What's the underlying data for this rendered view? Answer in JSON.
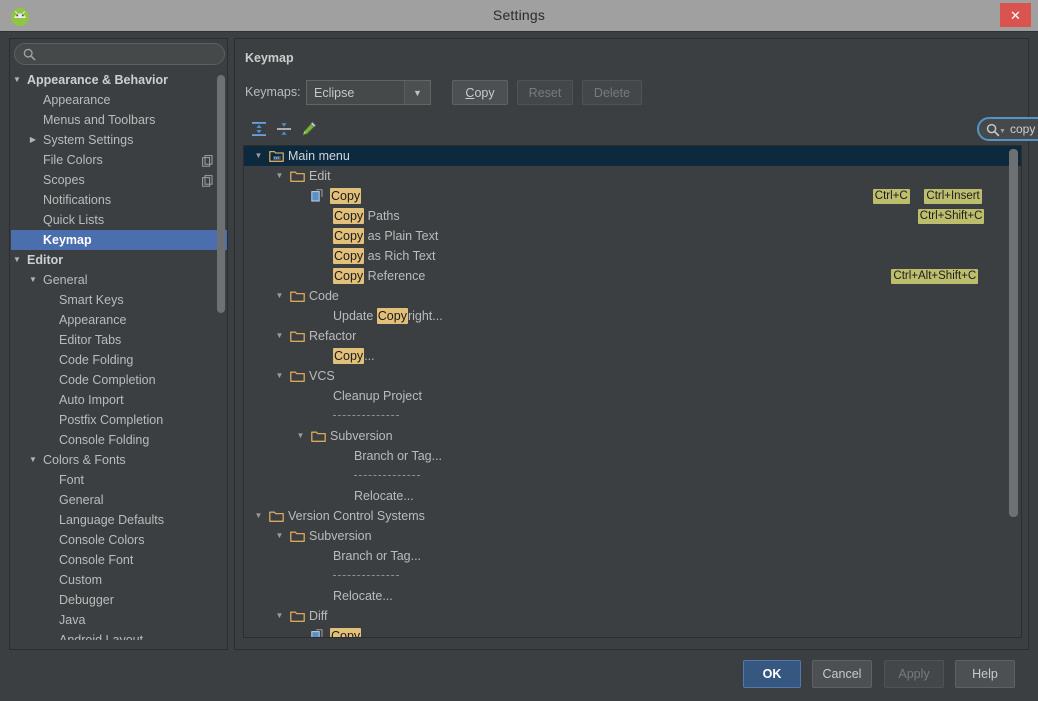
{
  "window": {
    "title": "Settings",
    "app_icon": "android-studio-icon",
    "close_label": "✕"
  },
  "sidebar": {
    "search": {
      "value": "",
      "placeholder": "",
      "icon": "search-icon"
    },
    "items": [
      {
        "label": "Appearance & Behavior",
        "depth": 0,
        "twisty": "▼",
        "bold": true,
        "selected": false,
        "badge": false
      },
      {
        "label": "Appearance",
        "depth": 1,
        "twisty": "",
        "bold": false,
        "selected": false,
        "badge": false
      },
      {
        "label": "Menus and Toolbars",
        "depth": 1,
        "twisty": "",
        "bold": false,
        "selected": false,
        "badge": false
      },
      {
        "label": "System Settings",
        "depth": 1,
        "twisty": "▶",
        "bold": false,
        "selected": false,
        "badge": false
      },
      {
        "label": "File Colors",
        "depth": 1,
        "twisty": "",
        "bold": false,
        "selected": false,
        "badge": true
      },
      {
        "label": "Scopes",
        "depth": 1,
        "twisty": "",
        "bold": false,
        "selected": false,
        "badge": true
      },
      {
        "label": "Notifications",
        "depth": 1,
        "twisty": "",
        "bold": false,
        "selected": false,
        "badge": false
      },
      {
        "label": "Quick Lists",
        "depth": 1,
        "twisty": "",
        "bold": false,
        "selected": false,
        "badge": false
      },
      {
        "label": "Keymap",
        "depth": 1,
        "twisty": "",
        "bold": true,
        "selected": true,
        "badge": false
      },
      {
        "label": "Editor",
        "depth": 0,
        "twisty": "▼",
        "bold": true,
        "selected": false,
        "badge": false
      },
      {
        "label": "General",
        "depth": 1,
        "twisty": "▼",
        "bold": false,
        "selected": false,
        "badge": false
      },
      {
        "label": "Smart Keys",
        "depth": 2,
        "twisty": "",
        "bold": false,
        "selected": false,
        "badge": false
      },
      {
        "label": "Appearance",
        "depth": 2,
        "twisty": "",
        "bold": false,
        "selected": false,
        "badge": false
      },
      {
        "label": "Editor Tabs",
        "depth": 2,
        "twisty": "",
        "bold": false,
        "selected": false,
        "badge": false
      },
      {
        "label": "Code Folding",
        "depth": 2,
        "twisty": "",
        "bold": false,
        "selected": false,
        "badge": false
      },
      {
        "label": "Code Completion",
        "depth": 2,
        "twisty": "",
        "bold": false,
        "selected": false,
        "badge": false
      },
      {
        "label": "Auto Import",
        "depth": 2,
        "twisty": "",
        "bold": false,
        "selected": false,
        "badge": false
      },
      {
        "label": "Postfix Completion",
        "depth": 2,
        "twisty": "",
        "bold": false,
        "selected": false,
        "badge": false
      },
      {
        "label": "Console Folding",
        "depth": 2,
        "twisty": "",
        "bold": false,
        "selected": false,
        "badge": false
      },
      {
        "label": "Colors & Fonts",
        "depth": 1,
        "twisty": "▼",
        "bold": false,
        "selected": false,
        "badge": false
      },
      {
        "label": "Font",
        "depth": 2,
        "twisty": "",
        "bold": false,
        "selected": false,
        "badge": false
      },
      {
        "label": "General",
        "depth": 2,
        "twisty": "",
        "bold": false,
        "selected": false,
        "badge": false
      },
      {
        "label": "Language Defaults",
        "depth": 2,
        "twisty": "",
        "bold": false,
        "selected": false,
        "badge": false
      },
      {
        "label": "Console Colors",
        "depth": 2,
        "twisty": "",
        "bold": false,
        "selected": false,
        "badge": false
      },
      {
        "label": "Console Font",
        "depth": 2,
        "twisty": "",
        "bold": false,
        "selected": false,
        "badge": false
      },
      {
        "label": "Custom",
        "depth": 2,
        "twisty": "",
        "bold": false,
        "selected": false,
        "badge": false
      },
      {
        "label": "Debugger",
        "depth": 2,
        "twisty": "",
        "bold": false,
        "selected": false,
        "badge": false
      },
      {
        "label": "Java",
        "depth": 2,
        "twisty": "",
        "bold": false,
        "selected": false,
        "badge": false
      },
      {
        "label": "Android Layout",
        "depth": 2,
        "twisty": "",
        "bold": false,
        "selected": false,
        "badge": false
      }
    ]
  },
  "panel": {
    "title": "Keymap",
    "keymaps_label": "Keymaps:",
    "keymap_selected": "Eclipse",
    "keymap_options": [
      "Eclipse"
    ],
    "buttons": {
      "copy_mnemonic": "C",
      "copy_rest": "opy",
      "reset": "Reset",
      "delete": "Delete"
    },
    "toolbar": {
      "expand_all": "expand-all-icon",
      "collapse_all": "collapse-all-icon",
      "edit": "edit-pencil-icon",
      "filter": "filter-shortcut-icon",
      "reset_filter": "trash-icon"
    },
    "find": {
      "value": "copy",
      "placeholder": "",
      "search_icon": "search-icon",
      "dropdown_icon": "chevron-down-icon",
      "clear_icon": "clear-circle-icon"
    }
  },
  "keymap_tree": [
    {
      "depth": 0,
      "twisty": "▼",
      "icon": "menu-folder-icon",
      "text": "Main menu",
      "hl": "",
      "selected": true,
      "shortcuts": [],
      "sep": false
    },
    {
      "depth": 1,
      "twisty": "▼",
      "icon": "folder-icon",
      "text": "Edit",
      "hl": "",
      "selected": false,
      "shortcuts": [],
      "sep": false
    },
    {
      "depth": 2,
      "twisty": "",
      "icon": "copy-action-icon",
      "text": "Copy",
      "hl": "Copy",
      "selected": false,
      "shortcuts": [
        "Ctrl+C",
        "Ctrl+Insert"
      ],
      "sep": false
    },
    {
      "depth": 3,
      "twisty": "",
      "icon": "",
      "text": "Copy Paths",
      "hl": "Copy",
      "selected": false,
      "shortcuts": [
        "Ctrl+Shift+C"
      ],
      "sep": false
    },
    {
      "depth": 3,
      "twisty": "",
      "icon": "",
      "text": "Copy as Plain Text",
      "hl": "Copy",
      "selected": false,
      "shortcuts": [],
      "sep": false
    },
    {
      "depth": 3,
      "twisty": "",
      "icon": "",
      "text": "Copy as Rich Text",
      "hl": "Copy",
      "selected": false,
      "shortcuts": [],
      "sep": false
    },
    {
      "depth": 3,
      "twisty": "",
      "icon": "",
      "text": "Copy Reference",
      "hl": "Copy",
      "selected": false,
      "shortcuts": [
        "Ctrl+Alt+Shift+C"
      ],
      "sep": false
    },
    {
      "depth": 1,
      "twisty": "▼",
      "icon": "folder-icon",
      "text": "Code",
      "hl": "",
      "selected": false,
      "shortcuts": [],
      "sep": false
    },
    {
      "depth": 3,
      "twisty": "",
      "icon": "",
      "text": "Update Copyright...",
      "hl": "Copy",
      "selected": false,
      "shortcuts": [],
      "sep": false
    },
    {
      "depth": 1,
      "twisty": "▼",
      "icon": "folder-icon",
      "text": "Refactor",
      "hl": "",
      "selected": false,
      "shortcuts": [],
      "sep": false
    },
    {
      "depth": 3,
      "twisty": "",
      "icon": "",
      "text": "Copy...",
      "hl": "Copy",
      "selected": false,
      "shortcuts": [],
      "sep": false
    },
    {
      "depth": 1,
      "twisty": "▼",
      "icon": "folder-icon",
      "text": "VCS",
      "hl": "",
      "selected": false,
      "shortcuts": [],
      "sep": false
    },
    {
      "depth": 3,
      "twisty": "",
      "icon": "",
      "text": "Cleanup Project",
      "hl": "",
      "selected": false,
      "shortcuts": [],
      "sep": false
    },
    {
      "depth": 3,
      "twisty": "",
      "icon": "",
      "text": "",
      "hl": "",
      "selected": false,
      "shortcuts": [],
      "sep": true
    },
    {
      "depth": 2,
      "twisty": "▼",
      "icon": "folder-icon",
      "text": "Subversion",
      "hl": "",
      "selected": false,
      "shortcuts": [],
      "sep": false
    },
    {
      "depth": 4,
      "twisty": "",
      "icon": "",
      "text": "Branch or Tag...",
      "hl": "",
      "selected": false,
      "shortcuts": [],
      "sep": false
    },
    {
      "depth": 4,
      "twisty": "",
      "icon": "",
      "text": "",
      "hl": "",
      "selected": false,
      "shortcuts": [],
      "sep": true
    },
    {
      "depth": 4,
      "twisty": "",
      "icon": "",
      "text": "Relocate...",
      "hl": "",
      "selected": false,
      "shortcuts": [],
      "sep": false
    },
    {
      "depth": 0,
      "twisty": "▼",
      "icon": "folder-icon",
      "text": "Version Control Systems",
      "hl": "",
      "selected": false,
      "shortcuts": [],
      "sep": false
    },
    {
      "depth": 1,
      "twisty": "▼",
      "icon": "folder-icon",
      "text": "Subversion",
      "hl": "",
      "selected": false,
      "shortcuts": [],
      "sep": false
    },
    {
      "depth": 3,
      "twisty": "",
      "icon": "",
      "text": "Branch or Tag...",
      "hl": "",
      "selected": false,
      "shortcuts": [],
      "sep": false
    },
    {
      "depth": 3,
      "twisty": "",
      "icon": "",
      "text": "",
      "hl": "",
      "selected": false,
      "shortcuts": [],
      "sep": true
    },
    {
      "depth": 3,
      "twisty": "",
      "icon": "",
      "text": "Relocate...",
      "hl": "",
      "selected": false,
      "shortcuts": [],
      "sep": false
    },
    {
      "depth": 1,
      "twisty": "▼",
      "icon": "folder-icon",
      "text": "Diff",
      "hl": "",
      "selected": false,
      "shortcuts": [],
      "sep": false
    },
    {
      "depth": 2,
      "twisty": "",
      "icon": "copy-action-icon",
      "text": "Copy",
      "hl": "Copy",
      "selected": false,
      "shortcuts": [],
      "sep": false
    }
  ],
  "footer": {
    "ok": "OK",
    "cancel": "Cancel",
    "apply": "Apply",
    "help": "Help"
  },
  "colors": {
    "window_chrome": "#a0a0a0",
    "dialog_bg": "#3c3f41",
    "selection_blue": "#4b6eaf",
    "tree_selection": "#0d293e",
    "highlight_match": "#e3c07a",
    "shortcut_badge": "#bdbd6e",
    "accent_focus": "#5394c9",
    "close_red": "#d9534f",
    "ok_blue": "#365880"
  }
}
